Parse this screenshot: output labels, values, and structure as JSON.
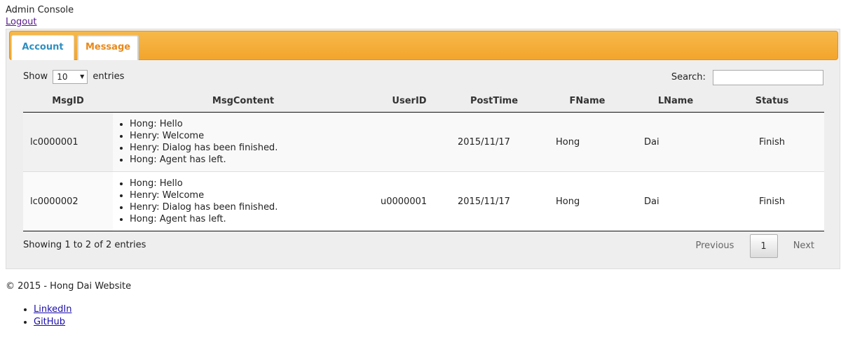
{
  "header": {
    "title": "Admin Console",
    "logout_label": "Logout"
  },
  "tabs": [
    {
      "label": "Account",
      "active": false
    },
    {
      "label": "Message",
      "active": true
    }
  ],
  "controls": {
    "show_label": "Show",
    "entries_label": "entries",
    "page_length": "10",
    "search_label": "Search:",
    "search_value": ""
  },
  "table": {
    "columns": [
      "MsgID",
      "MsgContent",
      "UserID",
      "PostTime",
      "FName",
      "LName",
      "Status"
    ],
    "rows": [
      {
        "msg_id": "lc0000001",
        "content": [
          "Hong: Hello",
          "Henry: Welcome",
          "Henry: Dialog has been finished.",
          "Hong: Agent has left."
        ],
        "user_id": "",
        "post_time": "2015/11/17",
        "fname": "Hong",
        "lname": "Dai",
        "status": "Finish"
      },
      {
        "msg_id": "lc0000002",
        "content": [
          "Hong: Hello",
          "Henry: Welcome",
          "Henry: Dialog has been finished.",
          "Hong: Agent has left."
        ],
        "user_id": "u0000001",
        "post_time": "2015/11/17",
        "fname": "Hong",
        "lname": "Dai",
        "status": "Finish"
      }
    ]
  },
  "info_text": "Showing 1 to 2 of 2 entries",
  "pagination": {
    "previous_label": "Previous",
    "current_page": "1",
    "next_label": "Next"
  },
  "footer": {
    "copyright": "© 2015 - Hong Dai Website",
    "links": [
      {
        "label": "LinkedIn"
      },
      {
        "label": "GitHub"
      }
    ]
  },
  "colors": {
    "tabbar_orange": "#f3a52c",
    "account_tab_text": "#2e8fc0",
    "message_tab_text": "#e8891c",
    "panel_bg": "#eeeeee"
  }
}
